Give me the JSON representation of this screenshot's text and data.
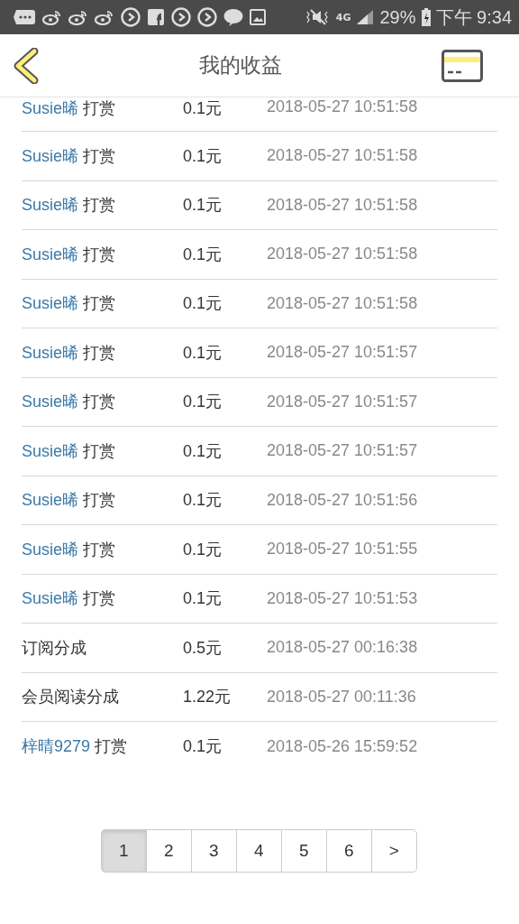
{
  "status_bar": {
    "network": "4G",
    "battery": "29%",
    "time": "下午 9:34"
  },
  "header": {
    "title": "我的收益"
  },
  "records": [
    {
      "kind": "tip",
      "user": "Susie晞",
      "action": "打赏",
      "amount": "0.1元",
      "time": "2018-05-27 10:51:58"
    },
    {
      "kind": "tip",
      "user": "Susie晞",
      "action": "打赏",
      "amount": "0.1元",
      "time": "2018-05-27 10:51:58"
    },
    {
      "kind": "tip",
      "user": "Susie晞",
      "action": "打赏",
      "amount": "0.1元",
      "time": "2018-05-27 10:51:58"
    },
    {
      "kind": "tip",
      "user": "Susie晞",
      "action": "打赏",
      "amount": "0.1元",
      "time": "2018-05-27 10:51:58"
    },
    {
      "kind": "tip",
      "user": "Susie晞",
      "action": "打赏",
      "amount": "0.1元",
      "time": "2018-05-27 10:51:58"
    },
    {
      "kind": "tip",
      "user": "Susie晞",
      "action": "打赏",
      "amount": "0.1元",
      "time": "2018-05-27 10:51:57"
    },
    {
      "kind": "tip",
      "user": "Susie晞",
      "action": "打赏",
      "amount": "0.1元",
      "time": "2018-05-27 10:51:57"
    },
    {
      "kind": "tip",
      "user": "Susie晞",
      "action": "打赏",
      "amount": "0.1元",
      "time": "2018-05-27 10:51:57"
    },
    {
      "kind": "tip",
      "user": "Susie晞",
      "action": "打赏",
      "amount": "0.1元",
      "time": "2018-05-27 10:51:56"
    },
    {
      "kind": "tip",
      "user": "Susie晞",
      "action": "打赏",
      "amount": "0.1元",
      "time": "2018-05-27 10:51:55"
    },
    {
      "kind": "tip",
      "user": "Susie晞",
      "action": "打赏",
      "amount": "0.1元",
      "time": "2018-05-27 10:51:53"
    },
    {
      "kind": "share",
      "label": "订阅分成",
      "amount": "0.5元",
      "time": "2018-05-27 00:16:38"
    },
    {
      "kind": "share",
      "label": "会员阅读分成",
      "amount": "1.22元",
      "time": "2018-05-27 00:11:36"
    },
    {
      "kind": "tip",
      "user": "梓晴9279",
      "action": "打赏",
      "amount": "0.1元",
      "time": "2018-05-26 15:59:52"
    }
  ],
  "pagination": [
    {
      "label": "1",
      "selected": true
    },
    {
      "label": "2",
      "selected": false
    },
    {
      "label": "3",
      "selected": false
    },
    {
      "label": "4",
      "selected": false
    },
    {
      "label": "5",
      "selected": false
    },
    {
      "label": "6",
      "selected": false
    },
    {
      "label": ">",
      "selected": false
    }
  ]
}
